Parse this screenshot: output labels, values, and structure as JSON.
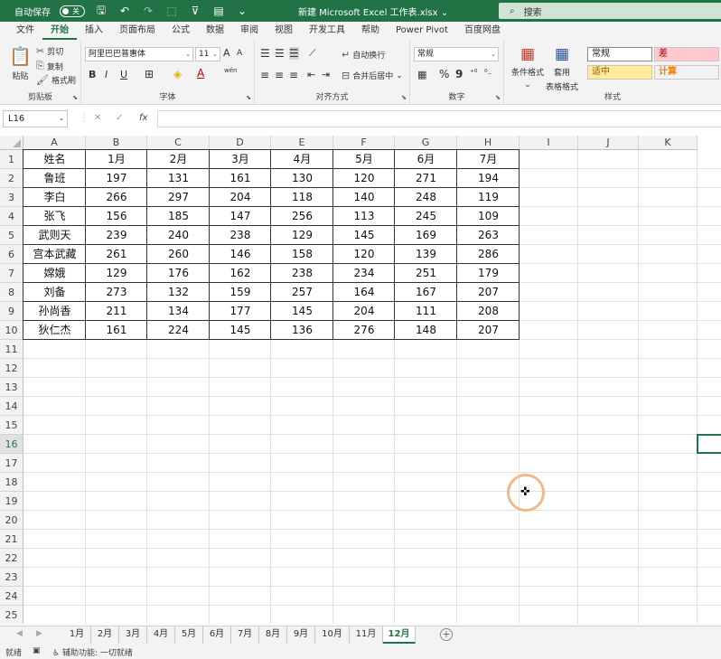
{
  "titlebar": {
    "autosave_label": "自动保存",
    "autosave_state": "关",
    "doc_title": "新建 Microsoft Excel 工作表.xlsx",
    "doc_title_caret": "⌄",
    "search_placeholder": "搜索"
  },
  "tabs": [
    "文件",
    "开始",
    "插入",
    "页面布局",
    "公式",
    "数据",
    "审阅",
    "视图",
    "开发工具",
    "帮助",
    "Power Pivot",
    "百度网盘"
  ],
  "active_tab": "开始",
  "ribbon": {
    "clipboard": {
      "label": "剪贴板",
      "paste": "粘贴",
      "cut": "剪切",
      "copy": "复制",
      "format_painter": "格式刷"
    },
    "font": {
      "label": "字体",
      "font_name": "阿里巴巴普惠体",
      "font_size": "11",
      "bold": "B",
      "italic": "I",
      "underline": "U",
      "grow": "A",
      "shrink": "A",
      "wen": "wén"
    },
    "alignment": {
      "label": "对齐方式",
      "wrap": "自动换行",
      "merge": "合并后居中"
    },
    "number": {
      "label": "数字",
      "format": "常规",
      "percent": "%",
      "comma": "9"
    },
    "styles": {
      "label": "样式",
      "conditional": "条件格式",
      "table_format_1": "套用",
      "table_format_2": "表格格式",
      "normal": "常规",
      "bad": "差",
      "neutral": "适中",
      "calc": "计算"
    }
  },
  "formula": {
    "name_box": "L16",
    "cancel": "✕",
    "enter": "✓",
    "fx": "fx",
    "content": ""
  },
  "columns": [
    "A",
    "B",
    "C",
    "D",
    "E",
    "F",
    "G",
    "H",
    "I",
    "J",
    "K"
  ],
  "rows": [
    "1",
    "2",
    "3",
    "4",
    "5",
    "6",
    "7",
    "8",
    "9",
    "10",
    "11",
    "12",
    "13",
    "14",
    "15",
    "16",
    "17",
    "18",
    "19",
    "20",
    "21",
    "22",
    "23",
    "24",
    "25"
  ],
  "selected_row": "16",
  "table": {
    "header": [
      "姓名",
      "1月",
      "2月",
      "3月",
      "4月",
      "5月",
      "6月",
      "7月"
    ],
    "rows": [
      [
        "鲁班",
        "197",
        "131",
        "161",
        "130",
        "120",
        "271",
        "194"
      ],
      [
        "李白",
        "266",
        "297",
        "204",
        "118",
        "140",
        "248",
        "119"
      ],
      [
        "张飞",
        "156",
        "185",
        "147",
        "256",
        "113",
        "245",
        "109"
      ],
      [
        "武则天",
        "239",
        "240",
        "238",
        "129",
        "145",
        "169",
        "263"
      ],
      [
        "宫本武藏",
        "261",
        "260",
        "146",
        "158",
        "120",
        "139",
        "286"
      ],
      [
        "嫦娥",
        "129",
        "176",
        "162",
        "238",
        "234",
        "251",
        "179"
      ],
      [
        "刘备",
        "273",
        "132",
        "159",
        "257",
        "164",
        "167",
        "207"
      ],
      [
        "孙尚香",
        "211",
        "134",
        "177",
        "145",
        "204",
        "111",
        "208"
      ],
      [
        "狄仁杰",
        "161",
        "224",
        "145",
        "136",
        "276",
        "148",
        "207"
      ]
    ]
  },
  "sheets": [
    "1月",
    "2月",
    "3月",
    "4月",
    "5月",
    "6月",
    "7月",
    "8月",
    "9月",
    "10月",
    "11月",
    "12月"
  ],
  "active_sheet": "12月",
  "status": {
    "ready": "就绪",
    "accessibility": "辅助功能: 一切就绪"
  },
  "colors": {
    "brand": "#217346",
    "bad_bg": "#ffc7ce",
    "bad_fg": "#9c0006",
    "neutral_bg": "#ffeb9c",
    "neutral_fg": "#9c5700",
    "calc_bg": "#f2f2f2",
    "calc_fg": "#fa7d00"
  }
}
